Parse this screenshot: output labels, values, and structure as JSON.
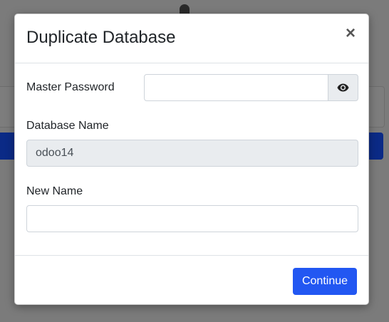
{
  "modal": {
    "title": "Duplicate Database",
    "close_label": "×",
    "fields": {
      "master_password": {
        "label": "Master Password",
        "value": "",
        "placeholder": "",
        "toggle_icon": "eye-icon"
      },
      "database_name": {
        "label": "Database Name",
        "value": "odoo14"
      },
      "new_name": {
        "label": "New Name",
        "value": "",
        "placeholder": ""
      }
    },
    "footer": {
      "continue_label": "Continue"
    }
  },
  "colors": {
    "primary": "#2257f2",
    "overlay": "#7b7b7b",
    "readonly_bg": "#e9ecef"
  }
}
